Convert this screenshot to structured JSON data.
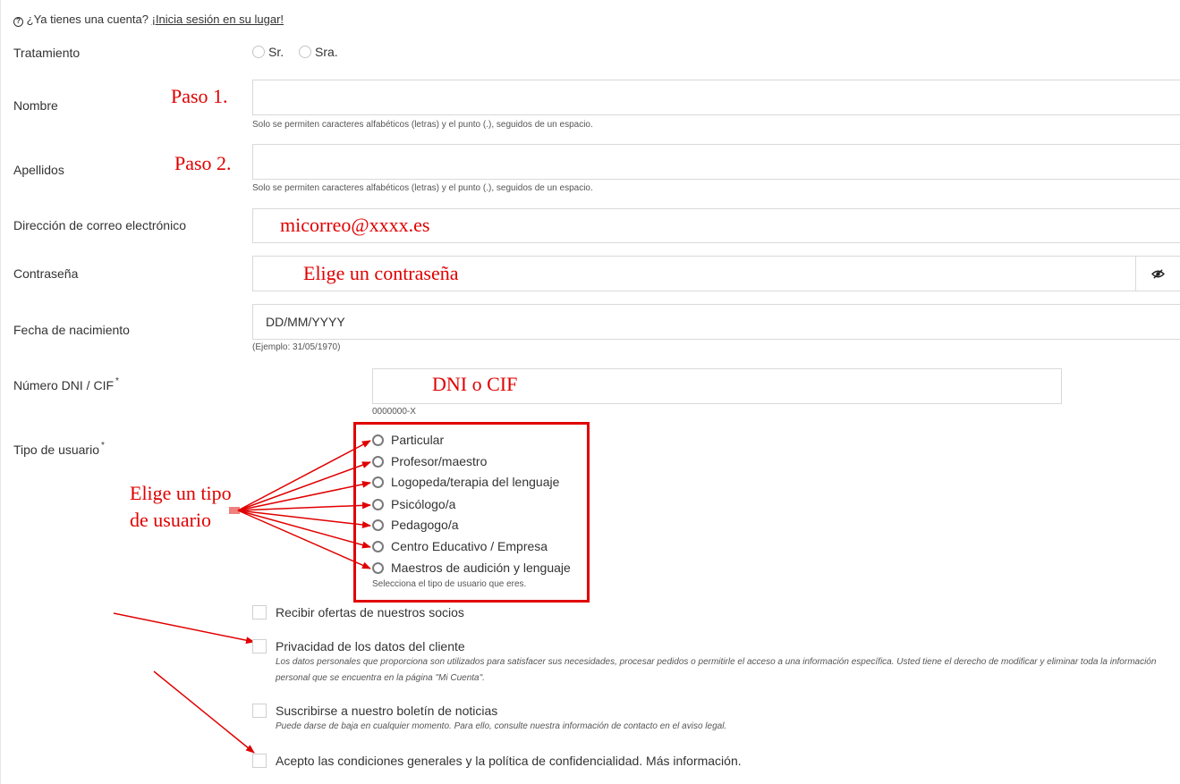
{
  "login_prompt": {
    "question": "¿Ya tienes una cuenta?",
    "link": "¡Inicia sesión en su lugar!"
  },
  "form": {
    "tratamiento": {
      "label": "Tratamiento",
      "options": [
        "Sr.",
        "Sra."
      ]
    },
    "nombre": {
      "label": "Nombre",
      "value": "",
      "hint": "Solo se permiten caracteres alfabéticos (letras) y el punto (.), seguidos de un espacio."
    },
    "apellidos": {
      "label": "Apellidos",
      "value": "",
      "hint": "Solo se permiten caracteres alfabéticos (letras) y el punto (.), seguidos de un espacio."
    },
    "email": {
      "label": "Dirección de correo electrónico",
      "value": ""
    },
    "password": {
      "label": "Contraseña",
      "value": ""
    },
    "birthdate": {
      "label": "Fecha de nacimiento",
      "placeholder": "DD/MM/YYYY",
      "hint": "(Ejemplo: 31/05/1970)"
    },
    "dni": {
      "label": "Número DNI / CIF",
      "required_mark": "*",
      "value": "",
      "hint": "0000000-X"
    },
    "tipo_usuario": {
      "label": "Tipo de usuario",
      "required_mark": "*",
      "options": [
        "Particular",
        "Profesor/maestro",
        "Logopeda/terapia del lenguaje",
        "Psicólogo/a",
        "Pedagogo/a",
        "Centro Educativo / Empresa",
        "Maestros de audición y lenguaje"
      ],
      "hint": "Selecciona el tipo de usuario que eres."
    },
    "checkboxes": [
      {
        "label": "Recibir ofertas de nuestros socios",
        "desc": ""
      },
      {
        "label": "Privacidad de los datos del cliente",
        "desc": "Los datos personales que proporciona son utilizados para satisfacer sus necesidades, procesar pedidos o permitirle el acceso a una información específica. Usted tiene el derecho de modificar y eliminar toda la información personal que se encuentra en la página \"Mi Cuenta\"."
      },
      {
        "label": "Suscribirse a nuestro boletín de noticias",
        "desc": "Puede darse de baja en cualquier momento. Para ello, consulte nuestra información de contacto en el aviso legal."
      },
      {
        "label": "Acepto las condiciones generales y la política de confidencialidad. Más información.",
        "desc": ""
      }
    ]
  },
  "annotations": {
    "paso1": "Paso 1.",
    "paso2": "Paso 2.",
    "email_hint": "micorreo@xxxx.es",
    "password_hint": "Elige un contraseña",
    "dni_hint": "DNI o CIF",
    "tipo_hint_line1": "Elige un tipo",
    "tipo_hint_line2": "de usuario"
  },
  "icons": {
    "help": "question-circle-icon",
    "eye": "eye-slash-icon",
    "arrow": "red-arrow"
  },
  "colors": {
    "annotation_red": "#e00000",
    "border": "#d9d9d9",
    "text": "#333333"
  }
}
